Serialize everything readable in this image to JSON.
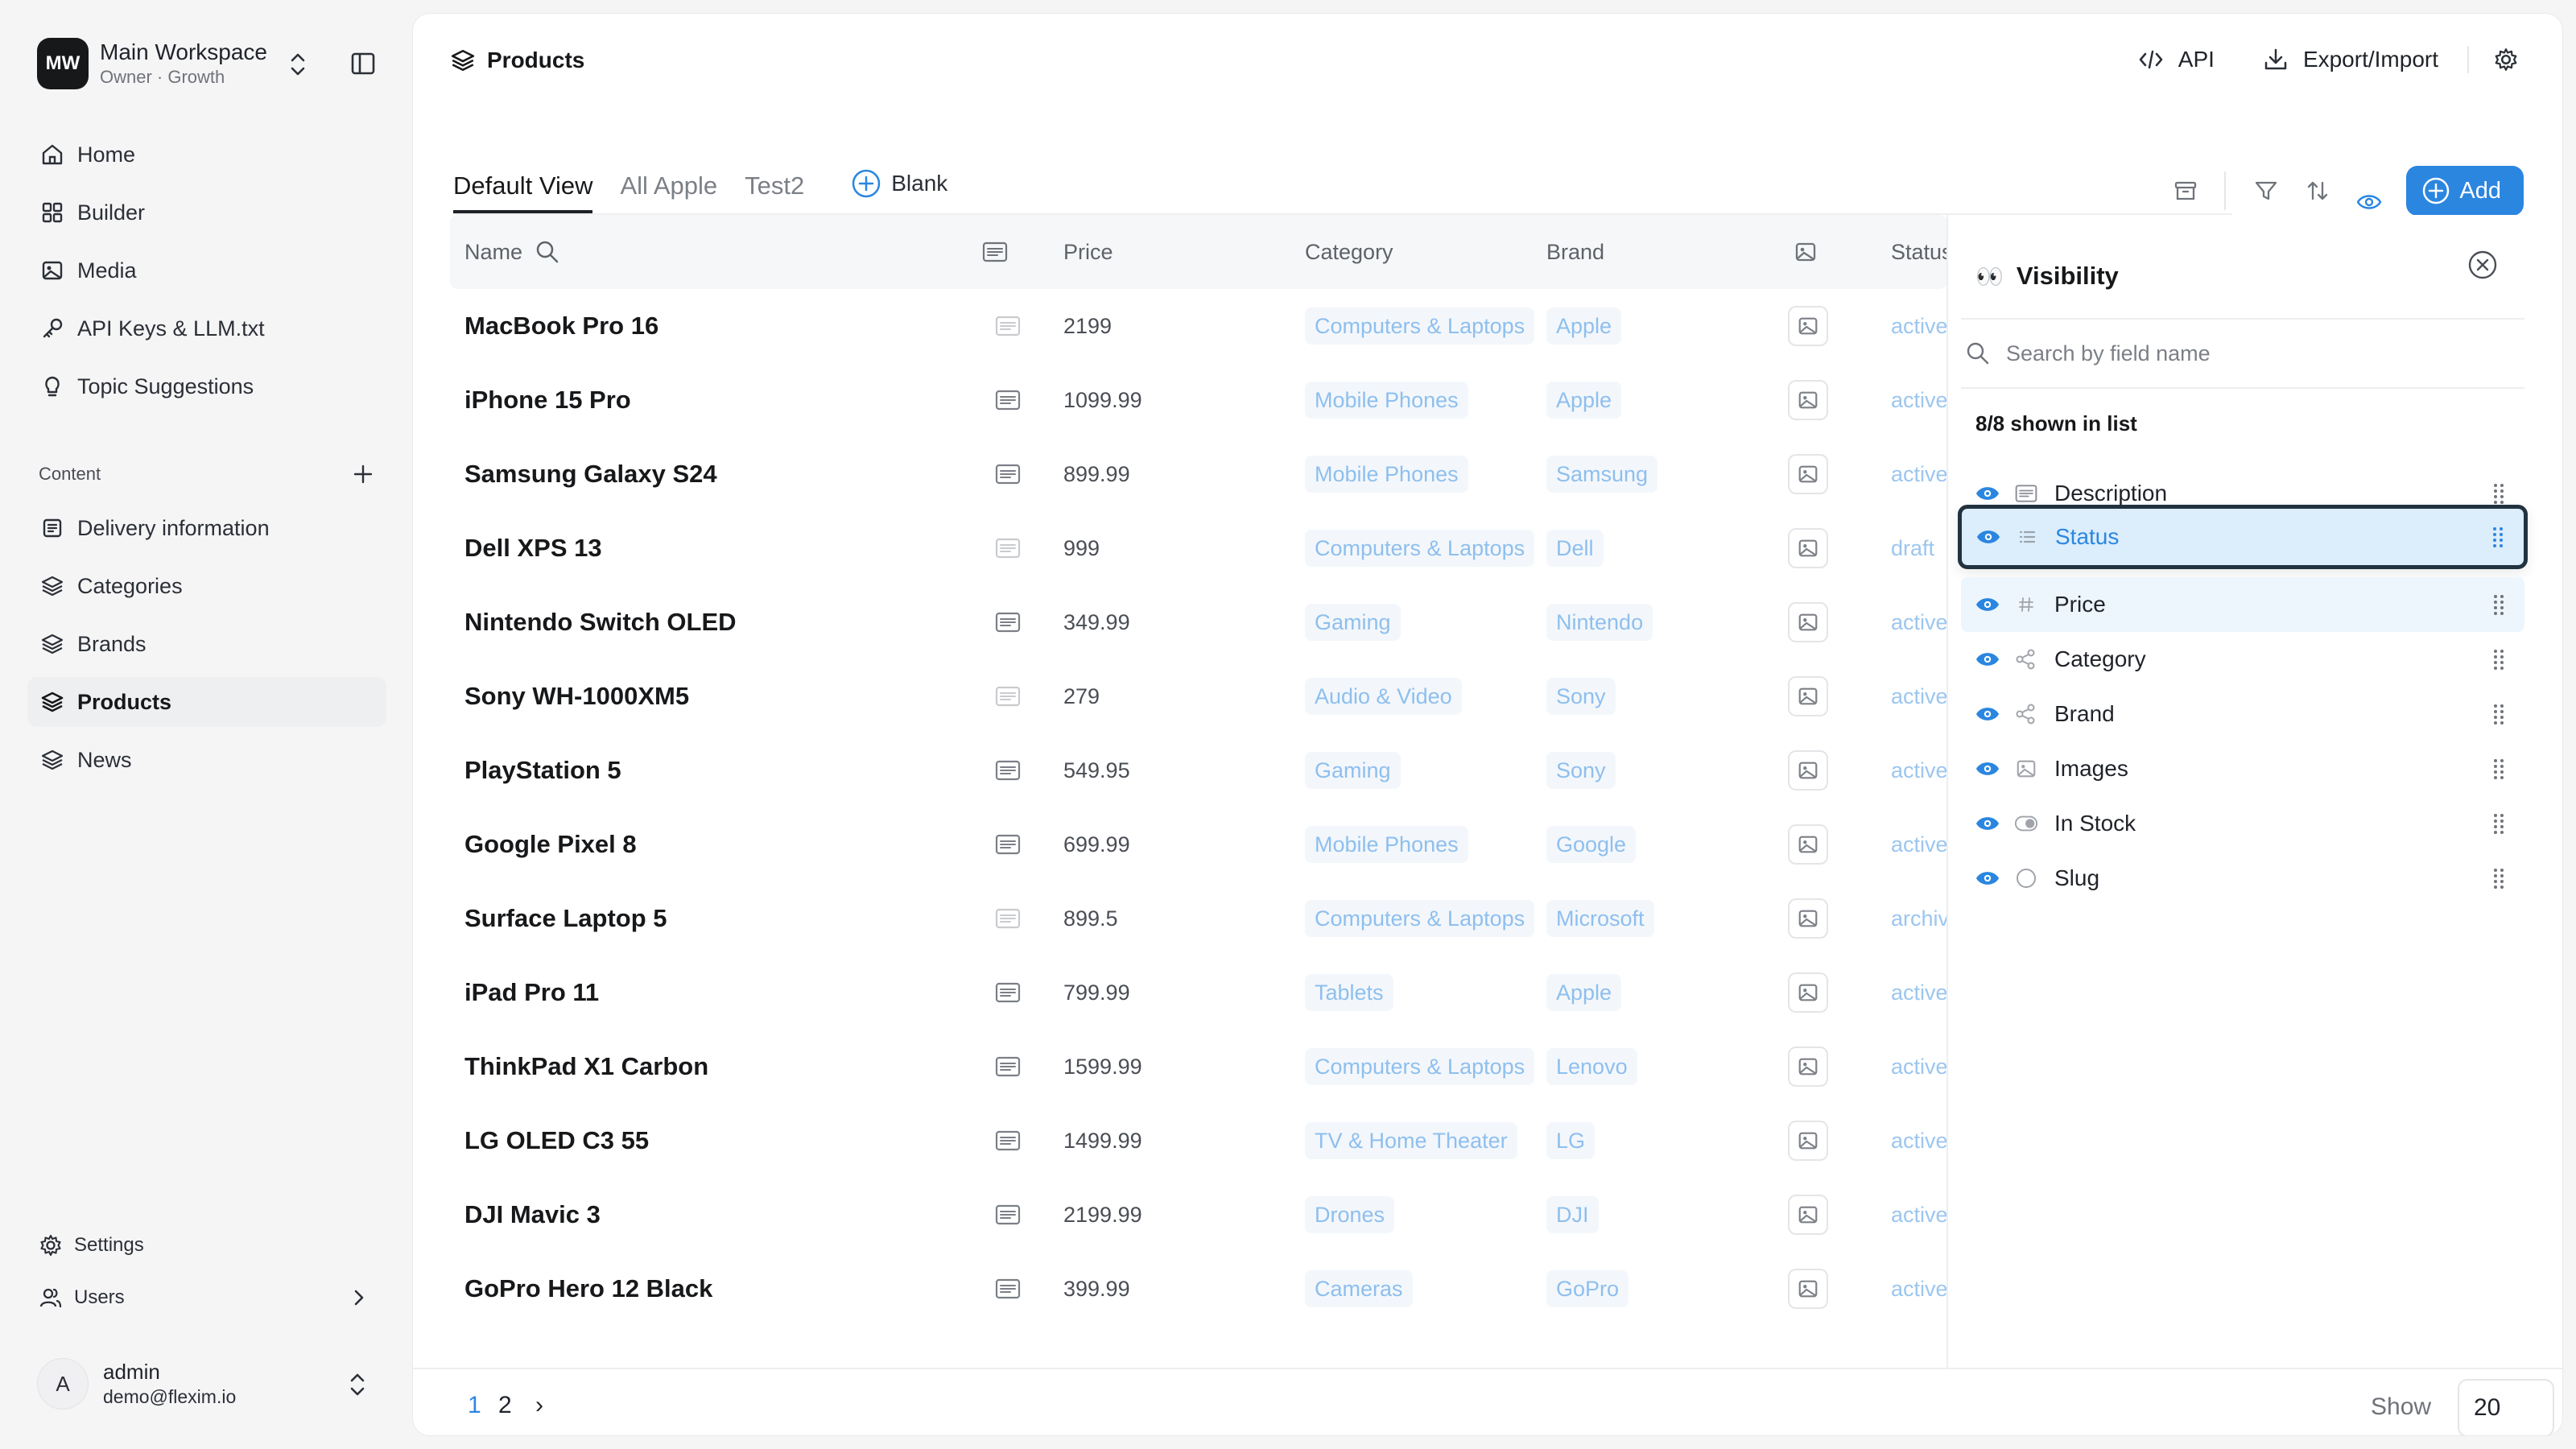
{
  "workspace": {
    "initials": "MW",
    "name": "Main Workspace",
    "subtitle": "Owner · Growth"
  },
  "nav": [
    {
      "label": "Home",
      "icon": "home-icon"
    },
    {
      "label": "Builder",
      "icon": "grid-icon"
    },
    {
      "label": "Media",
      "icon": "image-icon"
    },
    {
      "label": "API Keys & LLM.txt",
      "icon": "key-icon"
    },
    {
      "label": "Topic Suggestions",
      "icon": "lightbulb-icon"
    }
  ],
  "content_section": {
    "label": "Content"
  },
  "content_items": [
    {
      "label": "Delivery information",
      "icon": "file-text-icon"
    },
    {
      "label": "Categories",
      "icon": "layers-icon"
    },
    {
      "label": "Brands",
      "icon": "layers-icon"
    },
    {
      "label": "Products",
      "icon": "layers-icon",
      "active": true
    },
    {
      "label": "News",
      "icon": "layers-icon"
    }
  ],
  "bottom": {
    "settings": "Settings",
    "users": "Users"
  },
  "user": {
    "initial": "A",
    "name": "admin",
    "email": "demo@flexim.io"
  },
  "header": {
    "title": "Products",
    "api_label": "API",
    "export_label": "Export/Import"
  },
  "tabs": [
    {
      "label": "Default View",
      "active": true
    },
    {
      "label": "All Apple"
    },
    {
      "label": "Test2"
    }
  ],
  "blank_tab": "Blank",
  "add_label": "Add",
  "columns": {
    "name": "Name",
    "price": "Price",
    "category": "Category",
    "brand": "Brand",
    "status": "Status"
  },
  "rows": [
    {
      "name": "MacBook Pro 16",
      "desc_filled": false,
      "price": "2199",
      "category": "Computers & Laptops",
      "brand": "Apple",
      "status": "active"
    },
    {
      "name": "iPhone 15 Pro",
      "desc_filled": true,
      "price": "1099.99",
      "category": "Mobile Phones",
      "brand": "Apple",
      "status": "active"
    },
    {
      "name": "Samsung Galaxy S24",
      "desc_filled": true,
      "price": "899.99",
      "category": "Mobile Phones",
      "brand": "Samsung",
      "status": "active"
    },
    {
      "name": "Dell XPS 13",
      "desc_filled": false,
      "price": "999",
      "category": "Computers & Laptops",
      "brand": "Dell",
      "status": "draft"
    },
    {
      "name": "Nintendo Switch OLED",
      "desc_filled": true,
      "price": "349.99",
      "category": "Gaming",
      "brand": "Nintendo",
      "status": "active"
    },
    {
      "name": "Sony WH-1000XM5",
      "desc_filled": false,
      "price": "279",
      "category": "Audio & Video",
      "brand": "Sony",
      "status": "active"
    },
    {
      "name": "PlayStation 5",
      "desc_filled": true,
      "price": "549.95",
      "category": "Gaming",
      "brand": "Sony",
      "status": "active"
    },
    {
      "name": "Google Pixel 8",
      "desc_filled": true,
      "price": "699.99",
      "category": "Mobile Phones",
      "brand": "Google",
      "status": "active"
    },
    {
      "name": "Surface Laptop 5",
      "desc_filled": false,
      "price": "899.5",
      "category": "Computers & Laptops",
      "brand": "Microsoft",
      "status": "archived"
    },
    {
      "name": "iPad Pro 11",
      "desc_filled": true,
      "price": "799.99",
      "category": "Tablets",
      "brand": "Apple",
      "status": "active"
    },
    {
      "name": "ThinkPad X1 Carbon",
      "desc_filled": true,
      "price": "1599.99",
      "category": "Computers & Laptops",
      "brand": "Lenovo",
      "status": "active"
    },
    {
      "name": "LG OLED C3 55",
      "desc_filled": true,
      "price": "1499.99",
      "category": "TV & Home Theater",
      "brand": "LG",
      "status": "active"
    },
    {
      "name": "DJI Mavic 3",
      "desc_filled": true,
      "price": "2199.99",
      "category": "Drones",
      "brand": "DJI",
      "status": "active"
    },
    {
      "name": "GoPro Hero 12 Black",
      "desc_filled": true,
      "price": "399.99",
      "category": "Cameras",
      "brand": "GoPro",
      "status": "active"
    }
  ],
  "visibility": {
    "emoji": "👀",
    "title": "Visibility",
    "search_placeholder": "Search by field name",
    "count_label": "8/8 shown in list",
    "fields": [
      {
        "name": "Description",
        "type": "text-icon",
        "state": "normal"
      },
      {
        "name": "Status",
        "type": "list-icon",
        "state": "dragging"
      },
      {
        "name": "Price",
        "type": "hash-icon",
        "state": "highlight"
      },
      {
        "name": "Category",
        "type": "relation-icon",
        "state": "normal"
      },
      {
        "name": "Brand",
        "type": "relation-icon",
        "state": "normal"
      },
      {
        "name": "Images",
        "type": "image-icon",
        "state": "normal"
      },
      {
        "name": "In Stock",
        "type": "toggle-icon",
        "state": "normal"
      },
      {
        "name": "Slug",
        "type": "circle-icon",
        "state": "normal"
      }
    ]
  },
  "pagination": {
    "pages": [
      "1",
      "2"
    ],
    "current": "1",
    "next": "›",
    "show_label": "Show",
    "page_size": "20"
  },
  "colors": {
    "accent": "#2b86e0",
    "pill_text": "#8ebfee",
    "pill_bg": "#f3f7fb"
  }
}
